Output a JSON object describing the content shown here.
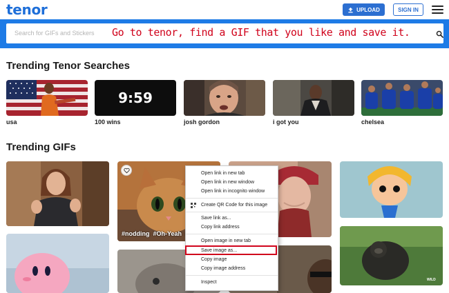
{
  "header": {
    "logo": "tenor",
    "upload_label": "UPLOAD",
    "signin_label": "SIGN IN"
  },
  "search": {
    "placeholder": "Search for GIFs and Stickers",
    "overlay_instruction": "Go to tenor, find a GIF that you like and save it."
  },
  "trending_searches": {
    "title": "Trending Tenor Searches",
    "items": [
      {
        "label": "usa"
      },
      {
        "label": "100 wins",
        "overlay_text": "9:59"
      },
      {
        "label": "josh gordon"
      },
      {
        "label": "i got you"
      },
      {
        "label": "chelsea"
      }
    ]
  },
  "trending_gifs": {
    "title": "Trending GIFs",
    "tags": [
      "#nodding",
      "#Oh-Yeah",
      "#"
    ],
    "watermark": "WILD"
  },
  "context_menu": {
    "items": [
      "Open link in new tab",
      "Open link in new window",
      "Open link in incognito window",
      "Create QR Code for this image",
      "Save link as...",
      "Copy link address",
      "Open image in new tab",
      "Save image as...",
      "Copy image",
      "Copy image address",
      "Inspect"
    ],
    "highlighted": "Save image as..."
  },
  "colors": {
    "brand_blue": "#1e7be6",
    "logo_blue": "#1e6fd9",
    "instruction_red": "#d0021b"
  }
}
